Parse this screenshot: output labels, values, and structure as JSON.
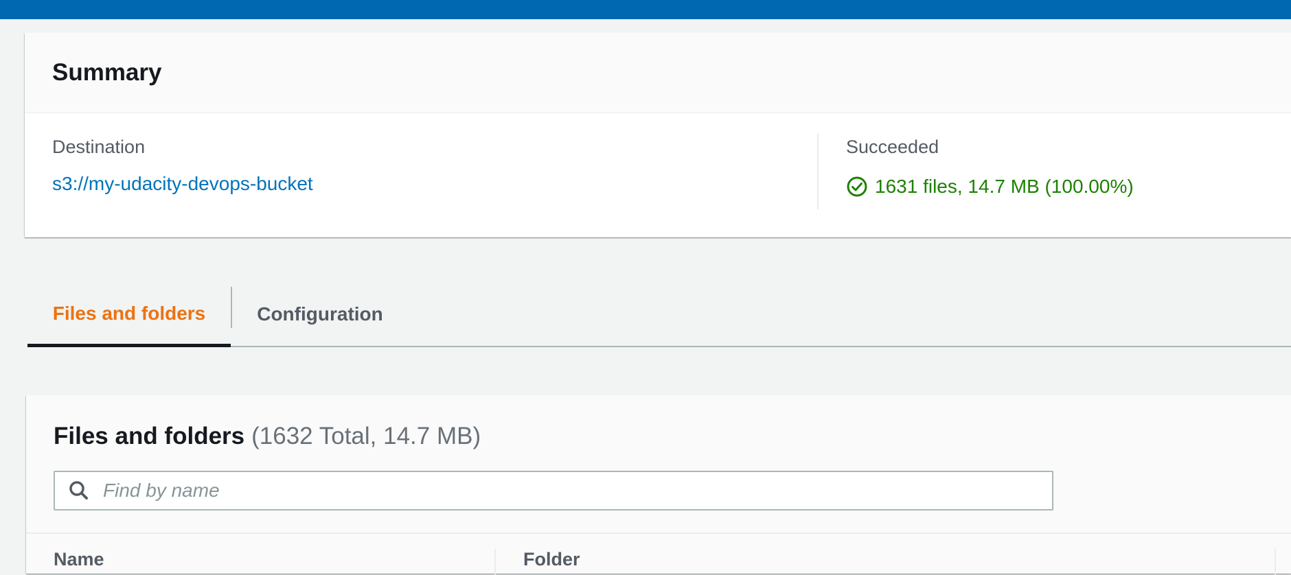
{
  "summary": {
    "title": "Summary",
    "destination_label": "Destination",
    "destination_value": "s3://my-udacity-devops-bucket",
    "succeeded_label": "Succeeded",
    "succeeded_value": "1631 files, 14.7 MB (100.00%)",
    "status_icon": "check-circle-icon"
  },
  "tabs": [
    {
      "label": "Files and folders",
      "active": true
    },
    {
      "label": "Configuration",
      "active": false
    }
  ],
  "files": {
    "title": "Files and folders",
    "counter": "(1632 Total, 14.7 MB)",
    "search_placeholder": "Find by name",
    "search_value": "",
    "columns": [
      "Name",
      "Folder"
    ]
  },
  "colors": {
    "top_bar": "#0067b1",
    "link": "#0073bb",
    "success": "#1d8102",
    "active_tab": "#ec7211"
  }
}
